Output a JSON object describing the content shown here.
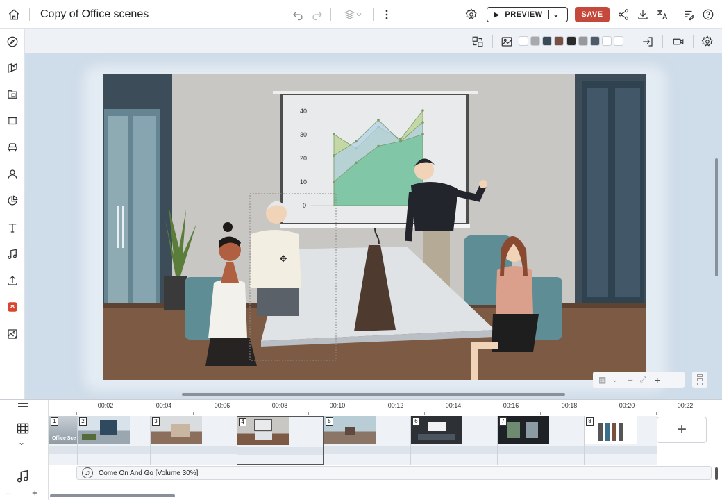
{
  "header": {
    "doc_title": "Copy of Office scenes",
    "preview_label": "PREVIEW",
    "save_label": "SAVE"
  },
  "sidebar": {
    "items": [
      {
        "icon": "compass-icon"
      },
      {
        "icon": "scenes-icon"
      },
      {
        "icon": "backgrounds-icon"
      },
      {
        "icon": "video-icon"
      },
      {
        "icon": "props-icon"
      },
      {
        "icon": "characters-icon"
      },
      {
        "icon": "charts-icon"
      },
      {
        "icon": "text-icon"
      },
      {
        "icon": "music-icon"
      },
      {
        "icon": "upload-icon"
      },
      {
        "icon": "plugin-icon"
      },
      {
        "icon": "image-edit-icon"
      }
    ]
  },
  "toolbar": {
    "swatches": [
      "#ffffff",
      "#a9a9a9",
      "#3b4a57",
      "#7a5040",
      "#2a2a2a",
      "#999999",
      "#4f5b66",
      "#ffffff",
      "#ffffff"
    ]
  },
  "scene_chart": {
    "type": "area",
    "y_ticks": [
      "40",
      "30",
      "20",
      "10",
      "0"
    ],
    "ylim": [
      0,
      40
    ],
    "x": [
      0,
      1,
      2,
      3,
      4
    ],
    "series": [
      {
        "values": [
          30,
          24,
          33,
          28,
          40
        ],
        "color": "#b8d28e"
      },
      {
        "values": [
          21,
          27,
          36,
          27,
          35
        ],
        "color": "#b2d0e5"
      },
      {
        "values": [
          10,
          18,
          25,
          27,
          30
        ],
        "color": "#6fc196"
      }
    ]
  },
  "timeline": {
    "ticks": [
      "00:02",
      "00:04",
      "00:06",
      "00:08",
      "00:10",
      "00:12",
      "00:14",
      "00:16",
      "00:18",
      "00:20",
      "00:22"
    ],
    "scenes": [
      {
        "num": "1",
        "caption": "Office Sce"
      },
      {
        "num": "2",
        "caption": ""
      },
      {
        "num": "3",
        "caption": ""
      },
      {
        "num": "4",
        "caption": ""
      },
      {
        "num": "5",
        "caption": ""
      },
      {
        "num": "6",
        "caption": ""
      },
      {
        "num": "7",
        "caption": ""
      },
      {
        "num": "8",
        "caption": ""
      }
    ],
    "audio_label": "Come On And Go [Volume 30%]"
  }
}
